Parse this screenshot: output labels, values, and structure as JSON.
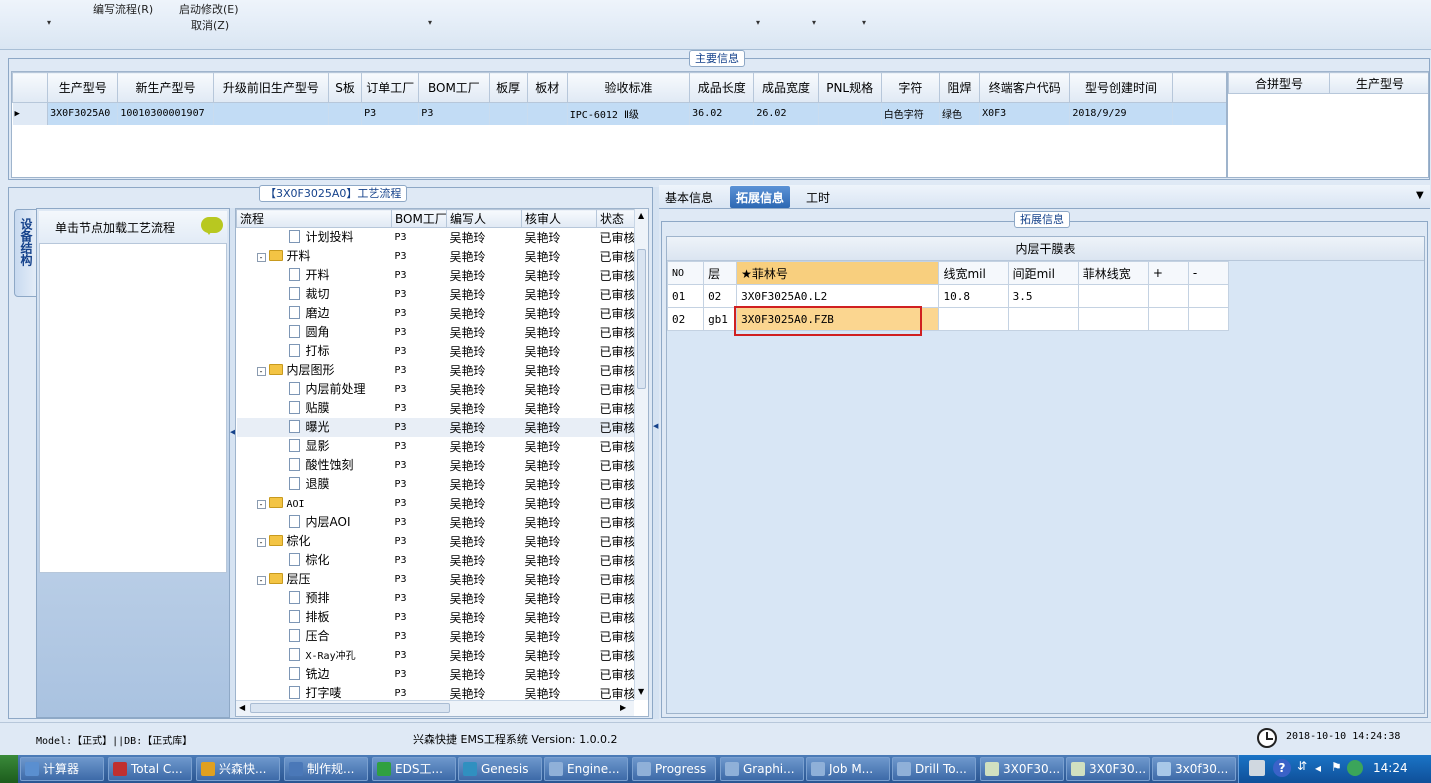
{
  "toolbar": {
    "menu1": "编写流程(R)",
    "menu2": "启动修改(E)",
    "menu3": "取消(Z)"
  },
  "main_info": {
    "title": "主要信息",
    "columns": [
      "生产型号",
      "新生产型号",
      "升级前旧生产型号",
      "S板",
      "订单工厂",
      "BOM工厂",
      "板厚",
      "板材",
      "验收标准",
      "成品长度",
      "成品宽度",
      "PNL规格",
      "字符",
      "阻焊",
      "终端客户代码",
      "型号创建时间"
    ],
    "row": [
      "3X0F3025A0",
      "10010300001907",
      "",
      "",
      "P3",
      "P3",
      "",
      "",
      "IPC-6012 Ⅱ级",
      "36.02",
      "26.02",
      "",
      "白色字符",
      "绿色",
      "X0F3",
      "2018/9/29"
    ],
    "side_columns": [
      "合拼型号",
      "生产型号"
    ]
  },
  "process": {
    "title": "【3X0F3025A0】工艺流程",
    "side_tab": "设备结构",
    "hint": "单击节点加载工艺流程",
    "columns": [
      "流程",
      "BOM工厂",
      "编写人",
      "核审人",
      "状态"
    ],
    "rows": [
      {
        "name": "计划投料",
        "kind": "doc",
        "bom": "P3",
        "writer": "吴艳玲",
        "reviewer": "吴艳玲",
        "status": "已审核"
      },
      {
        "name": "开料",
        "kind": "folder",
        "bom": "P3",
        "writer": "吴艳玲",
        "reviewer": "吴艳玲",
        "status": "已审核"
      },
      {
        "name": "开料",
        "kind": "doc",
        "bom": "P3",
        "writer": "吴艳玲",
        "reviewer": "吴艳玲",
        "status": "已审核"
      },
      {
        "name": "裁切",
        "kind": "doc",
        "bom": "P3",
        "writer": "吴艳玲",
        "reviewer": "吴艳玲",
        "status": "已审核"
      },
      {
        "name": "磨边",
        "kind": "doc",
        "bom": "P3",
        "writer": "吴艳玲",
        "reviewer": "吴艳玲",
        "status": "已审核"
      },
      {
        "name": "圆角",
        "kind": "doc",
        "bom": "P3",
        "writer": "吴艳玲",
        "reviewer": "吴艳玲",
        "status": "已审核"
      },
      {
        "name": "打标",
        "kind": "doc",
        "bom": "P3",
        "writer": "吴艳玲",
        "reviewer": "吴艳玲",
        "status": "已审核"
      },
      {
        "name": "内层图形",
        "kind": "folder",
        "bom": "P3",
        "writer": "吴艳玲",
        "reviewer": "吴艳玲",
        "status": "已审核"
      },
      {
        "name": "内层前处理",
        "kind": "doc",
        "bom": "P3",
        "writer": "吴艳玲",
        "reviewer": "吴艳玲",
        "status": "已审核"
      },
      {
        "name": "贴膜",
        "kind": "doc",
        "bom": "P3",
        "writer": "吴艳玲",
        "reviewer": "吴艳玲",
        "status": "已审核"
      },
      {
        "name": "曝光",
        "kind": "doc",
        "bom": "P3",
        "writer": "吴艳玲",
        "reviewer": "吴艳玲",
        "status": "已审核"
      },
      {
        "name": "显影",
        "kind": "doc",
        "bom": "P3",
        "writer": "吴艳玲",
        "reviewer": "吴艳玲",
        "status": "已审核"
      },
      {
        "name": "酸性蚀刻",
        "kind": "doc",
        "bom": "P3",
        "writer": "吴艳玲",
        "reviewer": "吴艳玲",
        "status": "已审核"
      },
      {
        "name": "退膜",
        "kind": "doc",
        "bom": "P3",
        "writer": "吴艳玲",
        "reviewer": "吴艳玲",
        "status": "已审核"
      },
      {
        "name": "AOI",
        "kind": "folder",
        "bom": "P3",
        "writer": "吴艳玲",
        "reviewer": "吴艳玲",
        "status": "已审核"
      },
      {
        "name": "内层AOI",
        "kind": "doc",
        "bom": "P3",
        "writer": "吴艳玲",
        "reviewer": "吴艳玲",
        "status": "已审核"
      },
      {
        "name": "棕化",
        "kind": "folder",
        "bom": "P3",
        "writer": "吴艳玲",
        "reviewer": "吴艳玲",
        "status": "已审核"
      },
      {
        "name": "棕化",
        "kind": "doc",
        "bom": "P3",
        "writer": "吴艳玲",
        "reviewer": "吴艳玲",
        "status": "已审核"
      },
      {
        "name": "层压",
        "kind": "folder",
        "bom": "P3",
        "writer": "吴艳玲",
        "reviewer": "吴艳玲",
        "status": "已审核"
      },
      {
        "name": "预排",
        "kind": "doc",
        "bom": "P3",
        "writer": "吴艳玲",
        "reviewer": "吴艳玲",
        "status": "已审核"
      },
      {
        "name": "排板",
        "kind": "doc",
        "bom": "P3",
        "writer": "吴艳玲",
        "reviewer": "吴艳玲",
        "status": "已审核"
      },
      {
        "name": "压合",
        "kind": "doc",
        "bom": "P3",
        "writer": "吴艳玲",
        "reviewer": "吴艳玲",
        "status": "已审核"
      },
      {
        "name": "X-Ray冲孔",
        "kind": "doc",
        "bom": "P3",
        "writer": "吴艳玲",
        "reviewer": "吴艳玲",
        "status": "已审核"
      },
      {
        "name": "铣边",
        "kind": "doc",
        "bom": "P3",
        "writer": "吴艳玲",
        "reviewer": "吴艳玲",
        "status": "已审核"
      },
      {
        "name": "打字唛",
        "kind": "doc",
        "bom": "P3",
        "writer": "吴艳玲",
        "reviewer": "吴艳玲",
        "status": "已审核"
      }
    ]
  },
  "detail": {
    "tabs": [
      "基本信息",
      "拓展信息",
      "工时"
    ],
    "active_tab": "拓展信息",
    "group_title": "拓展信息",
    "table_title": "内层干膜表",
    "columns": [
      "NO",
      "层",
      "★菲林号",
      "线宽mil",
      "间距mil",
      "菲林线宽",
      "+",
      "-"
    ],
    "rows": [
      [
        "01",
        "02",
        "3X0F3025A0.L2",
        "10.8",
        "3.5",
        "",
        "",
        ""
      ],
      [
        "02",
        "gb1",
        "3X0F3025A0.FZB",
        "",
        "",
        "",
        "",
        ""
      ]
    ]
  },
  "statusbar": {
    "model": "Model:【正式】||DB:【正式库】",
    "system": "兴森快捷 EMS工程系统  Version: 1.0.0.2",
    "datetime": "2018-10-10 14:24:38"
  },
  "taskbar": {
    "items": [
      {
        "label": "计算器",
        "color": "#5a8fd0"
      },
      {
        "label": "Total C...",
        "color": "#c03030"
      },
      {
        "label": "兴森快...",
        "color": "#e0a020"
      },
      {
        "label": "制作规...",
        "color": "#4a78b8"
      },
      {
        "label": "EDS工...",
        "color": "#30a040"
      },
      {
        "label": "Genesis",
        "color": "#3090c0"
      },
      {
        "label": "Engine...",
        "color": "#8fb0d8"
      },
      {
        "label": "Progress",
        "color": "#8fb0d8"
      },
      {
        "label": "Graphi...",
        "color": "#8fb0d8"
      },
      {
        "label": "Job M...",
        "color": "#8fb0d8"
      },
      {
        "label": "Drill To...",
        "color": "#8fb0d8"
      },
      {
        "label": "3X0F30...",
        "color": "#d0e0c0"
      },
      {
        "label": "3X0F30...",
        "color": "#d0e0c0"
      },
      {
        "label": "3x0f30...",
        "color": "#a8c8e8"
      }
    ],
    "clock": "14:24"
  }
}
